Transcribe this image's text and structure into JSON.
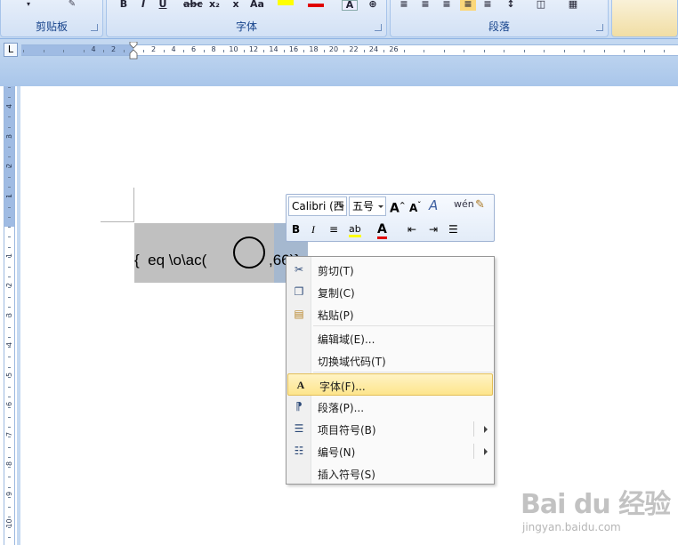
{
  "ribbon": {
    "groups": [
      {
        "label": "剪贴板"
      },
      {
        "label": "字体"
      },
      {
        "label": "段落"
      }
    ]
  },
  "document": {
    "field_code_before": "{  eq \\o\\ac(",
    "field_code_after": ",66)}"
  },
  "mini_toolbar": {
    "font_name": "Calibri (西",
    "font_size": "五号"
  },
  "context_menu": {
    "items": [
      {
        "label": "剪切(T)",
        "icon": "scissors-icon"
      },
      {
        "label": "复制(C)",
        "icon": "copy-icon"
      },
      {
        "label": "粘贴(P)",
        "icon": "paste-icon"
      },
      {
        "label": "编辑域(E)...",
        "icon": ""
      },
      {
        "label": "切换域代码(T)",
        "icon": ""
      },
      {
        "label": "字体(F)...",
        "icon": "font-icon"
      },
      {
        "label": "段落(P)...",
        "icon": "paragraph-icon"
      },
      {
        "label": "项目符号(B)",
        "icon": "bullets-icon"
      },
      {
        "label": "编号(N)",
        "icon": "numbering-icon"
      },
      {
        "label": "插入符号(S)",
        "icon": ""
      }
    ],
    "highlighted_index": 5
  },
  "ruler": {
    "h_numbers": [
      "4",
      "2",
      "2",
      "4",
      "6",
      "8",
      "10",
      "12",
      "14",
      "16",
      "18",
      "20",
      "22",
      "24",
      "26"
    ],
    "v_numbers": [
      "4",
      "3",
      "2",
      "1",
      "1",
      "2",
      "3",
      "4",
      "5",
      "6",
      "7",
      "8",
      "9",
      "10"
    ]
  },
  "watermark": {
    "brand": "Bai du 经验",
    "url": "jingyan.baidu.com"
  },
  "colors": {
    "ribbon_bg": "#c5d9f1",
    "field_shading": "#c0c0c0",
    "menu_highlight": "#fde58c"
  }
}
